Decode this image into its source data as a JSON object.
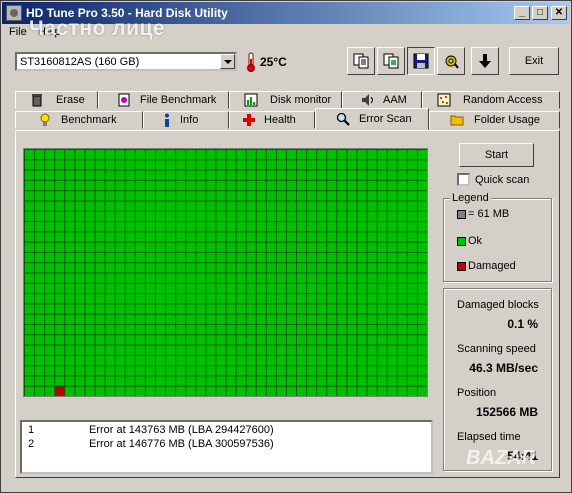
{
  "window": {
    "title": "HD Tune Pro 3.50 - Hard Disk Utility",
    "minimize": "_",
    "maximize": "□",
    "close": "✕"
  },
  "menu": {
    "file": "File",
    "help": "Help"
  },
  "overlay_text": "Частно лице",
  "toolbar": {
    "drive": "ST3160812AS (160 GB)",
    "temperature": "25°C",
    "buttons": [
      "copy-text-icon",
      "copy-screenshot-icon",
      "save-icon",
      "options-icon",
      "down-arrow-icon"
    ],
    "exit_label": "Exit"
  },
  "tabs_top": [
    {
      "label": "Erase",
      "icon": "trash-icon"
    },
    {
      "label": "File Benchmark",
      "icon": "file-benchmark-icon"
    },
    {
      "label": "Disk monitor",
      "icon": "disk-monitor-icon"
    },
    {
      "label": "AAM",
      "icon": "speaker-icon"
    },
    {
      "label": "Random Access",
      "icon": "random-access-icon"
    }
  ],
  "tabs_bottom": [
    {
      "label": "Benchmark",
      "icon": "lightbulb-icon"
    },
    {
      "label": "Info",
      "icon": "info-icon"
    },
    {
      "label": "Health",
      "icon": "health-cross-icon"
    },
    {
      "label": "Error Scan",
      "icon": "magnifier-icon",
      "active": true
    },
    {
      "label": "Folder Usage",
      "icon": "folder-icon"
    }
  ],
  "scan": {
    "columns": 40,
    "rows": 24,
    "ok_color": "#00c000",
    "damaged_color": "#c00000",
    "grid_color": "#006000",
    "damaged_blocks": [
      {
        "col": 3,
        "row": 23
      }
    ]
  },
  "log": [
    {
      "index": "1",
      "message": "Error at 143763 MB (LBA 294427600)"
    },
    {
      "index": "2",
      "message": "Error at 146776 MB (LBA 300597536)"
    }
  ],
  "controls": {
    "start_label": "Start",
    "quick_scan_label": "Quick scan",
    "quick_scan_checked": false
  },
  "legend": {
    "title": "Legend",
    "block_size": "= 61 MB",
    "ok": "Ok",
    "damaged": "Damaged",
    "block_color": "#808080"
  },
  "stats": {
    "damaged_blocks_label": "Damaged blocks",
    "damaged_blocks_value": "0.1 %",
    "speed_label": "Scanning speed",
    "speed_value": "46.3 MB/sec",
    "position_label": "Position",
    "position_value": "152566 MB",
    "elapsed_label": "Elapsed time",
    "elapsed_value": "54:41"
  },
  "watermark": "BAZAR"
}
